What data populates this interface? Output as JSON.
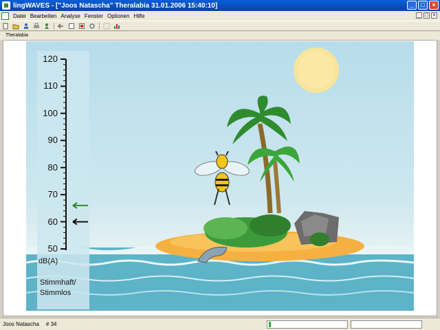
{
  "window": {
    "title": "lingWAVES - [\"Joos Natascha\" Theralabia  31.01.2006 15:40:10]",
    "buttons": {
      "minimize": "_",
      "maximize": "□",
      "close": "×"
    }
  },
  "menu": {
    "items": [
      "Datei",
      "Bearbeiten",
      "Analyse",
      "Fenster",
      "Optionen",
      "Hilfe"
    ],
    "mdi_buttons": {
      "minimize": "_",
      "restore": "□",
      "close": "×"
    }
  },
  "toolbar": {
    "icons": [
      "new-file-icon",
      "open-folder-icon",
      "user-icon",
      "print-icon",
      "person-icon",
      "back-arrow-icon",
      "stop-square-icon",
      "record-icon",
      "settings-icon",
      "zoom-icon",
      "chart-icon"
    ]
  },
  "document": {
    "label": "Theralabia"
  },
  "scale": {
    "ticks": [
      "120",
      "110",
      "100",
      "90",
      "80",
      "70",
      "60",
      "50"
    ],
    "unit": "dB(A)",
    "mode_line1": "Stimmhaft/",
    "mode_line2": "Stimmlos",
    "markers": [
      {
        "name": "current-level-marker",
        "value": 66,
        "color": "#2f8a2f"
      },
      {
        "name": "target-level-marker",
        "value": 60,
        "color": "#111111"
      }
    ]
  },
  "colors": {
    "sky": "#b6dceb",
    "sea": "#5db3c8",
    "sand": "#f6b041",
    "sun": "#f8e59a",
    "accent_green": "#36a836"
  },
  "statusbar": {
    "user": "Joos Natascha",
    "number": "#  34",
    "progress": 0.03
  }
}
